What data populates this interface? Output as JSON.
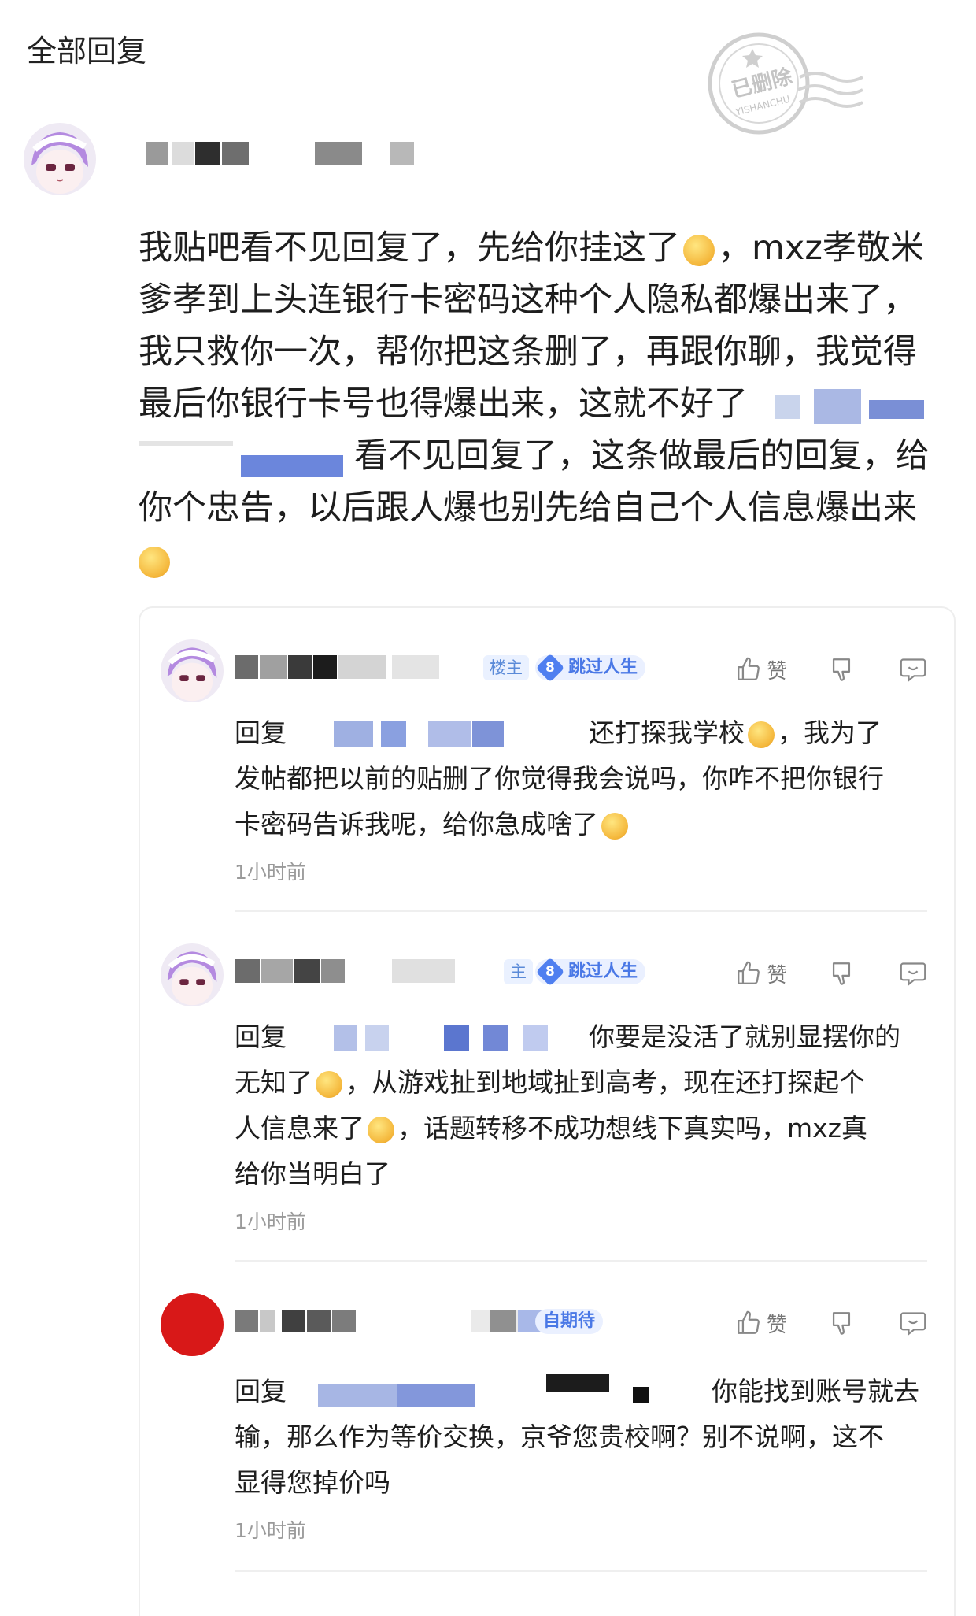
{
  "header": {
    "title": "全部回复"
  },
  "stamp": {
    "main": "已删除",
    "sub": "YISHANCHU"
  },
  "post": {
    "lines": [
      "我贴吧看不见回复了，先给你挂这了",
      "，mxz孝敬米",
      "爹孝到上头连银行卡密码这种个人隐私都爆出来了，",
      "我只救你一次，帮你把这条删了，再跟你聊，我觉得",
      "最后你银行卡号也得爆出来，这就不好了",
      "看不见回复了，这条做最后的回复，给",
      "你个忠告，以后跟人爆也别先给自己个人信息爆出来"
    ]
  },
  "replies": [
    {
      "host_badge": "楼主",
      "level": "8",
      "title": "跳过人生",
      "like_label": "赞",
      "prefix": "回复",
      "text_a": "还打探我学校",
      "text_b": "，我为了",
      "text_c": "发帖都把以前的贴删了你觉得我会说吗，你咋不把你银行",
      "text_d": "卡密码告诉我呢，给你急成啥了",
      "time": "1小时前"
    },
    {
      "host_badge": "主",
      "level": "8",
      "title": "跳过人生",
      "like_label": "赞",
      "prefix": "回复",
      "text_a": "你要是没活了就别显摆你的",
      "text_b": "无知了",
      "text_c": "，从游戏扯到地域扯到高考，现在还打探起个",
      "text_d": "人信息来了",
      "text_e": "，话题转移不成功想线下真实吗，mxz真",
      "text_f": "给你当明白了",
      "time": "1小时前"
    },
    {
      "title": "自期待",
      "like_label": "赞",
      "prefix": "回复",
      "text_a": "你能找到账号就去",
      "text_b": "输，那么作为等价交换，京爷您贵校啊？别不说啊，这不",
      "text_c": "显得您掉价吗",
      "time": "1小时前"
    }
  ],
  "icons": {
    "like": "thumbs-up-icon",
    "dislike": "thumbs-down-icon",
    "comment": "comment-icon"
  },
  "colors": {
    "accent": "#4f7ff0",
    "avatar_red": "#d81818",
    "muted": "#9a9a9a"
  }
}
